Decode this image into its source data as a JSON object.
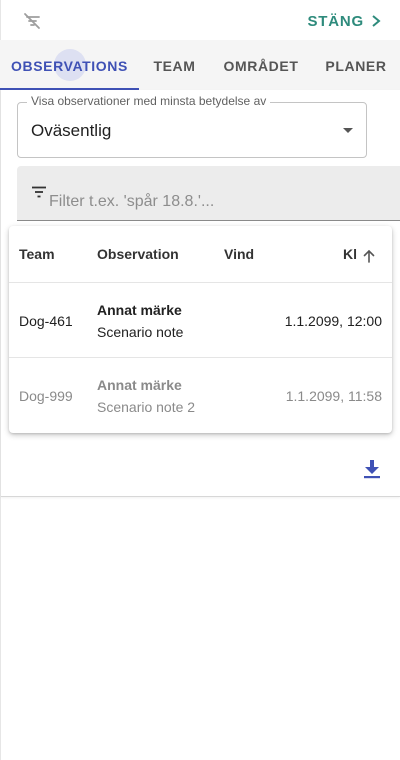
{
  "header": {
    "filter_off_icon": "filter-off-icon",
    "close_label": "STÄNG",
    "close_icon": "chevron-right-icon",
    "accent": "#2e8b7c"
  },
  "tabs": {
    "active_color": "#3f51b5",
    "items": [
      {
        "label": "OBSERVATIONS",
        "active": true
      },
      {
        "label": "TEAM",
        "active": false
      },
      {
        "label": "OMRÅDET",
        "active": false
      },
      {
        "label": "PLANER",
        "active": false
      }
    ]
  },
  "severity_select": {
    "label": "Visa observationer med minsta betydelse av",
    "value": "Oväsentlig"
  },
  "filter": {
    "icon": "filter-list-icon",
    "value": "",
    "placeholder": "Filter t.ex. 'spår 18.8.'..."
  },
  "table": {
    "headers": {
      "team": "Team",
      "observation": "Observation",
      "wind": "Vind",
      "time": "Kl"
    },
    "sort_icon": "arrow-up-icon",
    "rows": [
      {
        "team": "Dog-461",
        "title": "Annat märke",
        "note": "Scenario note",
        "wind": "",
        "time": "1.1.2099, 12:00",
        "muted": false
      },
      {
        "team": "Dog-999",
        "title": "Annat märke",
        "note": "Scenario note 2",
        "wind": "",
        "time": "1.1.2099, 11:58",
        "muted": true
      }
    ]
  },
  "download_icon": "download-icon"
}
